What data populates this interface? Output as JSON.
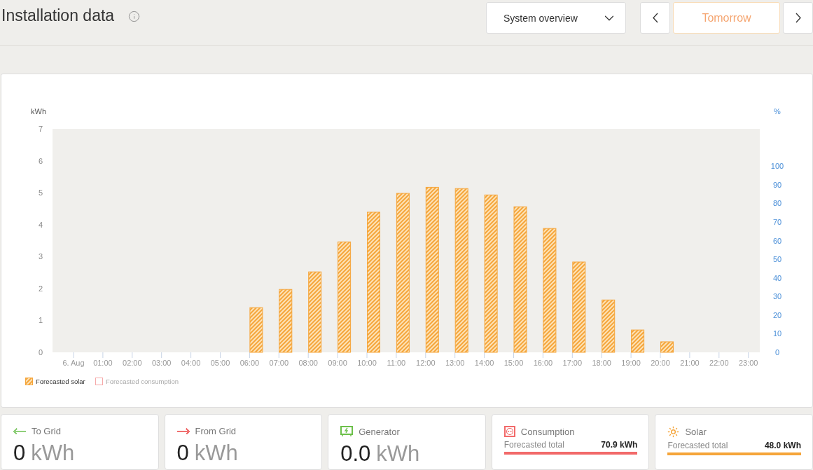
{
  "header": {
    "title": "Installation data",
    "view_select": {
      "value": "System overview"
    },
    "period": {
      "label": "Tomorrow"
    }
  },
  "chart": {
    "chart_data": {
      "type": "bar",
      "ylabel": "kWh",
      "y2label": "%",
      "categories": [
        "6. Aug",
        "01:00",
        "02:00",
        "03:00",
        "04:00",
        "05:00",
        "06:00",
        "07:00",
        "08:00",
        "09:00",
        "10:00",
        "11:00",
        "12:00",
        "13:00",
        "14:00",
        "15:00",
        "16:00",
        "17:00",
        "18:00",
        "19:00",
        "20:00",
        "21:00",
        "22:00",
        "23:00"
      ],
      "series": [
        {
          "name": "Forecasted solar",
          "color": "#f5a53a",
          "values": [
            0,
            0,
            0,
            0,
            0,
            0,
            1.4,
            1.97,
            2.52,
            3.46,
            4.39,
            4.98,
            5.17,
            5.13,
            4.93,
            4.56,
            3.88,
            2.83,
            1.64,
            0.7,
            0.33,
            0,
            0,
            0
          ]
        },
        {
          "name": "Forecasted consumption",
          "color": "#f07070",
          "values": [
            null,
            null,
            null,
            null,
            null,
            null,
            null,
            null,
            null,
            null,
            null,
            null,
            null,
            null,
            null,
            null,
            null,
            null,
            null,
            null,
            null,
            null,
            null,
            null
          ]
        }
      ],
      "ylim": [
        0,
        7
      ],
      "yticks": [
        0,
        1,
        2,
        3,
        4,
        5,
        6,
        7
      ],
      "y2lim": [
        0,
        120
      ],
      "y2ticks": [
        0,
        10,
        20,
        30,
        40,
        50,
        60,
        70,
        80,
        90,
        100
      ]
    }
  },
  "cards": [
    {
      "kind": "total",
      "label": "To Grid",
      "value": "0",
      "unit": "kWh",
      "color": "#8fcf7a"
    },
    {
      "kind": "total",
      "label": "From Grid",
      "value": "0",
      "unit": "kWh",
      "color": "#f07070"
    },
    {
      "kind": "total",
      "label": "Generator",
      "value": "0.0",
      "unit": "kWh",
      "color": "#6cc04a"
    },
    {
      "kind": "forecast",
      "label": "Consumption",
      "sub_label": "Forecasted total",
      "value": "70.9 kWh",
      "color": "#f26a6a"
    },
    {
      "kind": "forecast",
      "label": "Solar",
      "sub_label": "Forecasted total",
      "value": "48.0 kWh",
      "color": "#f5a53a"
    }
  ]
}
